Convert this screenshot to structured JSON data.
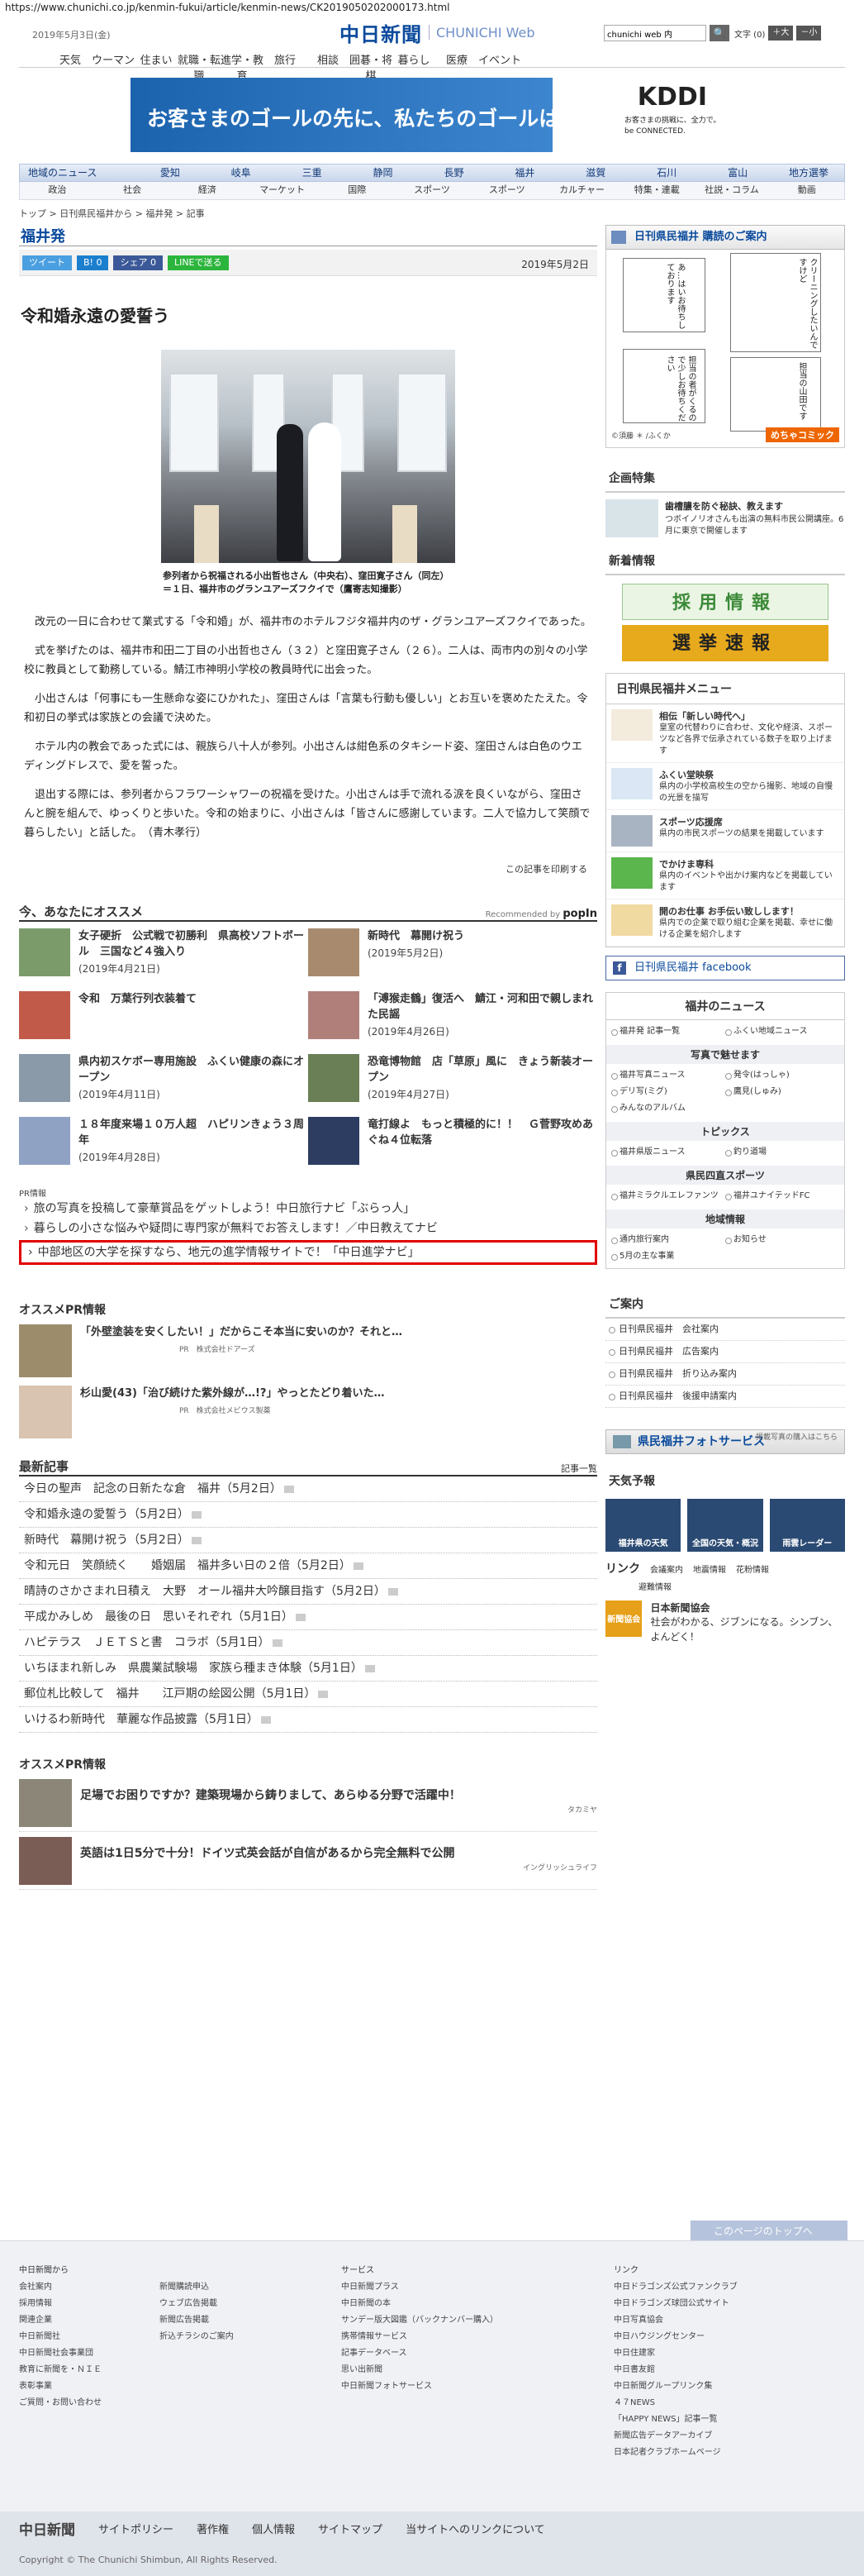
{
  "url": "https://www.chunichi.co.jp/kenmin-fukui/article/kenmin-news/CK2019050202000173.html",
  "header": {
    "date": "2019年5月3日(金)",
    "logo_jp": "中日新聞",
    "logo_en": "CHUNICHI Web",
    "search_value": "chunichi web 内",
    "search_btn": "🔍",
    "font_label": "文字 (0)",
    "font_big": "＋大",
    "font_small": "－小"
  },
  "topnav": [
    "天気",
    "ウーマン",
    "住まい",
    "就職・転職",
    "進学・教育",
    "旅行",
    "相談",
    "囲碁・将棋",
    "暮らし",
    "医療",
    "イベント"
  ],
  "ad": {
    "message": "お客さまのゴールの先に、私たちのゴールはある。",
    "brand": "KDDI",
    "sub": "お客さまの挑戦に、全力で。 be CONNECTED."
  },
  "sitenav": {
    "row1": [
      "地域のニュース",
      "愛知",
      "岐阜",
      "三重",
      "静岡",
      "長野",
      "福井",
      "滋賀",
      "石川",
      "富山",
      "地方選挙"
    ],
    "row2": [
      "政治",
      "社会",
      "経済",
      "マーケット",
      "国際",
      "スポーツ",
      "スポーツ",
      "カルチャー",
      "特集・連載",
      "社説・コラム",
      "動画"
    ]
  },
  "breadcrumb": "トップ > 日刊県民福井から > 福井発 > 記事",
  "section_title": "福井発",
  "share": {
    "tweet": "ツイート",
    "hatena": "B! 0",
    "fb": "シェア 0",
    "line": "LINEで送る",
    "date": "2019年5月2日"
  },
  "article": {
    "title": "令和婚永遠の愛誓う",
    "caption": "参列者から祝福される小出哲也さん（中央右）、窪田寛子さん（同左）＝１日、福井市のグランユアーズフクイで（鷹寄志知撮影）",
    "paragraphs": [
      "改元の一日に合わせて業式する「令和婚」が、福井市のホテルフジタ福井内のザ・グランユアーズフクイであった。",
      "式を挙げたのは、福井市和田二丁目の小出哲也さん（３２）と窪田寛子さん（２６）。二人は、両市内の別々の小学校に教員として勤務している。鯖江市神明小学校の教員時代に出会った。",
      "小出さんは「何事にも一生懸命な姿にひかれた」、窪田さんは「言葉も行動も優しい」とお互いを褒めたたえた。令和初日の挙式は家族との会議で決めた。",
      "ホテル内の教会であった式には、親族ら八十人が参列。小出さんは紺色系のタキシード姿、窪田さんは白色のウエディングドレスで、愛を誓った。",
      "退出する際には、参列者からフラワーシャワーの祝福を受けた。小出さんは手で流れる涙を良くいながら、窪田さんと腕を組んで、ゆっくりと歩いた。令和の始まりに、小出さんは「皆さんに感謝しています。二人で協力して笑顔で暮らしたい」と話した。　（青木孝行）"
    ],
    "print": "この記事を印刷する"
  },
  "osusume": {
    "title": "今、あなたにオススメ",
    "recommended": "Recommended by",
    "popin": "popIn",
    "items": [
      {
        "t": "女子硬折　公式戦で初勝利　県高校ソフトボール　三国など４強入り",
        "d": "(2019年4月21日)"
      },
      {
        "t": "新時代　幕開け祝う",
        "d": "(2019年5月2日)"
      },
      {
        "t": "令和　万葉行列衣装着て",
        "d": ""
      },
      {
        "t": "「溥猴走鶴」復活へ　鯖江・河和田で親しまれた民謡",
        "d": "(2019年4月26日)"
      },
      {
        "t": "県内初スケボー専用施設　ふくい健康の森にオープン",
        "d": "(2019年4月11日)"
      },
      {
        "t": "恐竜博物館　店「草原」風に　きょう新装オープン",
        "d": "(2019年4月27日)"
      },
      {
        "t": "１８年度来場１０万人超　ハピリンきょう３周年",
        "d": "(2019年4月28日)"
      },
      {
        "t": "竜打線よ　もっと積極的に！！　Ｇ菅野攻めあぐね４位転落",
        "d": ""
      }
    ]
  },
  "pr": {
    "label": "PR情報",
    "lines": [
      "旅の写真を投稿して豪華賞品をゲットしよう！中日旅行ナビ「ぶらっ人」",
      "暮らしの小さな悩みや疑問に専門家が無料でお答えします！／中日教えてナビ",
      "中部地区の大学を探すなら、地元の進学情報サイトで！「中日進学ナビ」"
    ]
  },
  "pr_info": {
    "title": "オススメPR情報",
    "items": [
      {
        "t": "「外壁塗装を安くしたい！」だからこそ本当に安いのか？それと…",
        "s": "PR　株式会社ドアーズ"
      },
      {
        "t": "杉山愛(43)「治び続けた紫外線が…!?」やっとたどり着いた…",
        "s": "PR　株式会社メビウス製薬"
      }
    ]
  },
  "latest": {
    "title": "最新記事",
    "more": "記事一覧",
    "items": [
      "今日の聖声　記念の日新たな倉　福井（5月2日）",
      "令和婚永遠の愛誓う（5月2日）",
      "新時代　幕開け祝う（5月2日）",
      "令和元日　笑顔続く　　婚姻届　福井多い日の２倍（5月2日）",
      "晴詩のさかさまれ日積え　大野　オール福井大吟醸目指す（5月2日）",
      "平成かみしめ　最後の日　思いそれぞれ（5月1日）",
      "ハピテラス　ＪＥＴＳと書　コラボ（5月1日）",
      "いちほまれ新しみ　県農業試験場　家族ら種まき体験（5月1日）",
      "郵位札比較して　福井　　江戸期の絵図公開（5月1日）",
      "いけるわ新時代　華麗な作品披露（5月1日）"
    ]
  },
  "pr2": {
    "title": "オススメPR情報",
    "items": [
      {
        "t": "足場でお困りですか？建築現場から鋳りまして、あらゆる分野で活躍中！",
        "s": "タカミヤ"
      },
      {
        "t": "英語は1日5分で十分！ドイツ式英会話が自信があるから完全無料で公開",
        "s": "イングリッシュライフ"
      }
    ]
  },
  "sidebar": {
    "comic_head": "日刊県民福井 購読のご案内",
    "comic_bubbles": [
      "あ…はいお待ちしております",
      "担当の者がくるので少しお待ちください",
      "クリーニングしたいんですけど",
      "担当の山田です"
    ],
    "comic_credit": "©須藤 ＊ /ふくか",
    "comic_label": "めちゃコミック",
    "feature_title": "企画特集",
    "feature": {
      "t1": "歯槽膿を防ぐ秘訣、教えます",
      "t2": "つボイノリオさんも出演の無料市民公開講座。6月に東京で開催します"
    },
    "new_info": "新着情報",
    "banner1": "採用情報",
    "banner2": "選挙速報",
    "menu_title": "日刊県民福井メニュー",
    "menu": [
      {
        "t1": "相伝「新しい時代へ」",
        "t2": "皇室の代替わりに合わせ、文化や経済、スポーツなど各界で伝承されている数子を取り上げます"
      },
      {
        "t1": "ふくい堂映祭",
        "t2": "県内の小学校高校生の空から撮影、地域の自慢の光景を描写"
      },
      {
        "t1": "スポーツ応援席",
        "t2": "県内の市民スポーツの結果を掲載しています"
      },
      {
        "t1": "でかけま専科",
        "t2": "県内のイベントや出かけ案内などを掲載しています"
      },
      {
        "t1": "開のお仕事 お手伝い致しします！",
        "t2": "県内での企業で取り組む企業を掲載、幸せに働ける企業を紹介します"
      }
    ],
    "facebook": "日刊県民福井 facebook",
    "news_title": "福井のニュース",
    "news_cols": [
      "福井発 記事一覧",
      "ふくい地域ニュース"
    ],
    "photo_title": "写真で魅せます",
    "photo_cols": [
      "福井写真ニュース",
      "発令(はっしゃ)",
      "デリ写(ミグ)",
      "鷹見(しゅみ)",
      "みんなのアルバム"
    ],
    "topics_title": "トピックス",
    "topics_cols": [
      "福井県版ニュース",
      "釣り道場"
    ],
    "sports_title": "県民四直スポーツ",
    "sports_cols": [
      "福井ミラクルエレファンツ",
      "福井ユナイテッドFC"
    ],
    "local_title": "地域情報",
    "local_cols": [
      "通内旅行案内",
      "お知らせ",
      "5月の主な事業"
    ],
    "guide_title": "ご案内",
    "guide": [
      "日刊県民福井　会社案内",
      "日刊県民福井　広告案内",
      "日刊県民福井　折り込み案内",
      "日刊県民福井　後援申請案内"
    ],
    "photosvc": "県民福井フォトサービス",
    "photosvc_sub": "掲載写真の購入はこちら",
    "weather_title": "天気予報",
    "weather": [
      "福井県の天気",
      "全国の天気・概況",
      "雨雲レーダー"
    ],
    "link_title": "リンク",
    "links": [
      "会議案内",
      "地震情報",
      "花粉情報",
      "避難情報"
    ],
    "book_title": "日本新聞協会",
    "book_text": "社会がわかる、ジブンになる。シンブン、よんどく！",
    "book_label": "新聞協会"
  },
  "totop": "このページのトップへ",
  "footer": {
    "cols": [
      {
        "hd": "中日新聞から",
        "it": [
          "会社案内",
          "採用情報",
          "関連企業",
          "中日新聞社",
          "中日新聞社会事業団",
          "教育に新聞を・ＮＩＥ",
          "表彰事業",
          "ご質問・お問い合わせ"
        ]
      },
      {
        "hd": "",
        "it": [
          "新聞購読申込",
          "ウェブ広告掲載",
          "新聞広告掲載",
          "折込チラシのご案内"
        ]
      },
      {
        "hd": "サービス",
        "it": [
          "中日新聞プラス",
          "中日新聞の本",
          "サンデー版大図鑑（バックナンバー購入）",
          "携帯情報サービス",
          "記事データベース",
          "思い出新聞",
          "中日新聞フォトサービス"
        ]
      },
      {
        "hd": "リンク",
        "it": [
          "中日ドラゴンズ公式ファンクラブ",
          "中日ドラゴンズ球団公式サイト",
          "中日写真協会",
          "中日ハウジングセンター",
          "中日住建家",
          "中日書友館",
          "中日新聞グループリンク集",
          "４７NEWS",
          "「HAPPY NEWS」記事一覧",
          "新聞広告データアーカイブ",
          "日本記者クラブホームページ"
        ]
      }
    ],
    "nav": [
      "中日新聞",
      "サイトポリシー",
      "著作権",
      "個人情報",
      "サイトマップ",
      "当サイトへのリンクについて"
    ],
    "copyright": "Copyright © The Chunichi Shimbun, All Rights Reserved."
  },
  "colors": {
    "accent": "#0a4a9c",
    "highlight": "#e10000"
  }
}
